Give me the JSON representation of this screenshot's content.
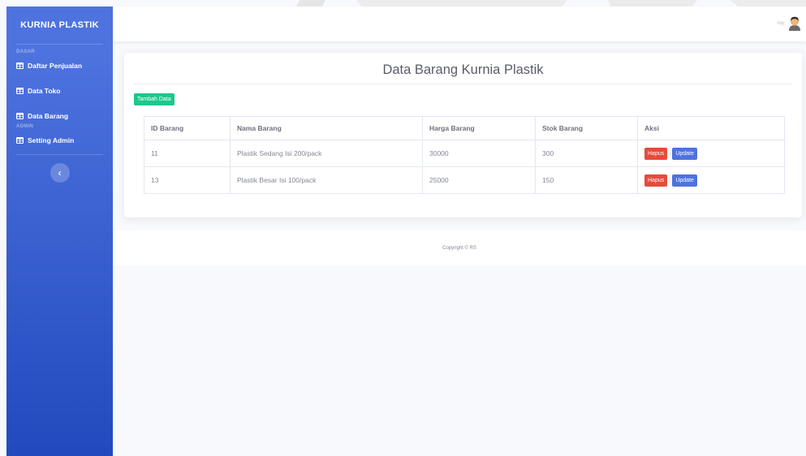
{
  "sidebar": {
    "brand": "KURNIA PLASTIK",
    "heading_dasar": "DASAR",
    "heading_admin": "ADMIN",
    "items": [
      {
        "label": "Daftar Penjualan",
        "icon": "table-icon"
      },
      {
        "label": "Data Toko",
        "icon": "table-icon"
      },
      {
        "label": "Data Barang",
        "icon": "table-icon"
      },
      {
        "label": "Setting Admin",
        "icon": "table-icon"
      }
    ],
    "toggle_icon": "chevron-left-icon",
    "toggle_glyph": "‹"
  },
  "topbar": {
    "user_name": "roy",
    "avatar_icon": "user-avatar-icon"
  },
  "main": {
    "title": "Data Barang Kurnia Plastik",
    "add_button": "Tambah Data",
    "table": {
      "headers": [
        "ID Barang",
        "Nama Barang",
        "Harga Barang",
        "Stok Barang",
        "Aksi"
      ],
      "rows": [
        {
          "id": "11",
          "nama": "Plastik Sedang Isi 200/pack",
          "harga": "30000",
          "stok": "300",
          "hapus": "Hapus",
          "sep": "|",
          "update": "Update"
        },
        {
          "id": "13",
          "nama": "Plastik Besar Isi 100/pack",
          "harga": "25000",
          "stok": "150",
          "hapus": "Hapus",
          "sep": "|",
          "update": "Update"
        }
      ]
    }
  },
  "footer": {
    "copyright": "Copyright © RS"
  },
  "colors": {
    "sidebar_top": "#4e73df",
    "sidebar_bottom": "#224abe",
    "success": "#1cc88a",
    "danger": "#e74a3b",
    "primary": "#4e73df"
  }
}
